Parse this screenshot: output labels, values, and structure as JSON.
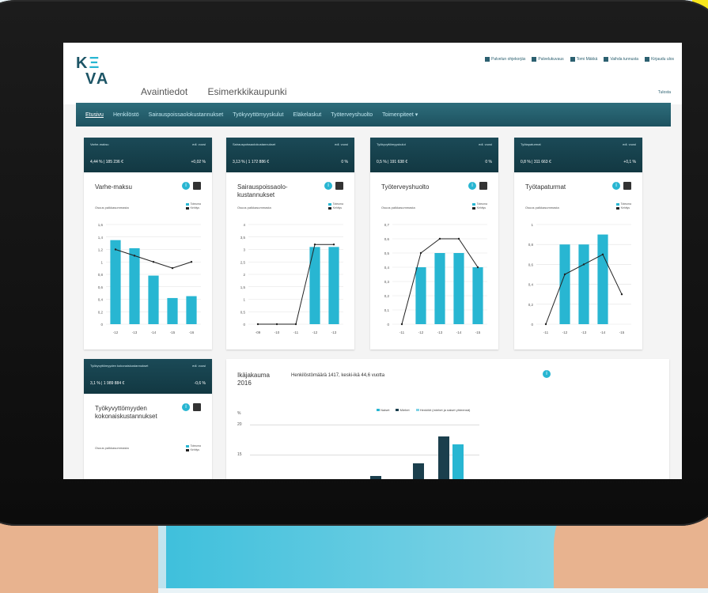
{
  "screen": {
    "title_app": "Avaintiedot",
    "title_org": "Esimerkkikaupunki",
    "top_links": [
      "Palvelun ohjekorjäs",
      "Palvelukuvaus",
      "Tomi Mäkkä",
      "Vaihda tunnusta",
      "Kirjaudu ulos"
    ],
    "print_label": "Tulosta",
    "nav": [
      "Etusivu",
      "Henkilöstö",
      "Sairauspoissaolokustannukset",
      "Työkyvyttömyyskulut",
      "Eläkelaskut",
      "Työterveyshuolto",
      "Toimenpiteet ▾"
    ]
  },
  "cards": [
    {
      "kpi_name": "Varhe-maksu",
      "kpi_info": "edl. vuosi",
      "kpi_value": "4,44 % | 185 236 €",
      "kpi_change": "+0,02 %",
      "title": "Varhe-maksu",
      "subhead": "Osuus palkkasummasta",
      "legend": [
        "Toteuma",
        "Kehitys"
      ],
      "chart_type": "bar+line",
      "categories": [
        "-12",
        "-13",
        "-14",
        "-15",
        "-16"
      ],
      "bars": [
        1.35,
        1.22,
        0.78,
        0.42,
        0.45
      ],
      "line": [
        1.2,
        1.1,
        1.0,
        0.9,
        1.0
      ],
      "ylim": [
        0,
        1.6
      ],
      "yticks": [
        "1,6",
        "1,4",
        "1,2",
        "1",
        "0,8",
        "0,6",
        "0,4",
        "0,2",
        "0"
      ]
    },
    {
      "kpi_name": "Sairauspoissaolokustannukset",
      "kpi_info": "edl. vuosi",
      "kpi_value": "3,13 % | 1 172 886 €",
      "kpi_change": "0 %",
      "title": "Sairauspoissaolo-kustannukset",
      "subhead": "Osuus palkkasummasta",
      "legend": [
        "Toteuma",
        "Kehitys"
      ],
      "chart_type": "bar+line",
      "categories": [
        "-09",
        "-10",
        "-11",
        "-12",
        "-13"
      ],
      "bars": [
        0,
        0,
        0,
        3.1,
        3.1
      ],
      "line": [
        0,
        0,
        0,
        3.2,
        3.2
      ],
      "ylim": [
        0,
        4
      ],
      "yticks": [
        "4",
        "3,5",
        "3",
        "2,5",
        "2",
        "1,5",
        "1",
        "0,5",
        "0"
      ]
    },
    {
      "kpi_name": "Työkyvyttömyyskulut",
      "kpi_info": "edl. vuosi",
      "kpi_value": "0,5 % | 191 638 €",
      "kpi_change": "0 %",
      "title": "Työterveyshuolto",
      "subhead": "Osuus palkkasummasta",
      "legend": [
        "Toteuma",
        "Kehitys"
      ],
      "chart_type": "bar+line",
      "categories": [
        "-11",
        "-12",
        "-13",
        "-14",
        "-15"
      ],
      "bars": [
        0,
        0.4,
        0.5,
        0.5,
        0.4
      ],
      "line": [
        0,
        0.5,
        0.6,
        0.6,
        0.4
      ],
      "ylim": [
        0,
        0.7
      ],
      "yticks": [
        "0,7",
        "0,6",
        "0,5",
        "0,4",
        "0,3",
        "0,2",
        "0,1",
        "0"
      ]
    },
    {
      "kpi_name": "Työtapaturmat",
      "kpi_info": "edl. vuosi",
      "kpi_value": "0,8 % | 311 663 €",
      "kpi_change": "+0,1 %",
      "title": "Työtapaturmat",
      "subhead": "Osuus palkkasummasta",
      "legend": [
        "Toteuma",
        "Kehitys"
      ],
      "chart_type": "bar+line",
      "categories": [
        "-11",
        "-12",
        "-13",
        "-14",
        "-15"
      ],
      "bars": [
        0,
        0.8,
        0.8,
        0.9,
        0
      ],
      "line": [
        0,
        0.5,
        0.6,
        0.7,
        0.3
      ],
      "ylim": [
        0,
        1
      ],
      "yticks": [
        "1",
        "0,8",
        "0,6",
        "0,4",
        "0,2",
        "0"
      ]
    }
  ],
  "bottom_left": {
    "kpi_name": "Työkyvyttömyyden kokonaiskustannukset",
    "kpi_info": "edl. vuosi",
    "kpi_value": "3,1 % | 1 989 884 €",
    "kpi_change": "-0,6 %",
    "title": "Työkyvyttömyyden kokonaiskustannukset",
    "subhead": "Osuus palkkasummasta",
    "legend": [
      "Toteuma",
      "Kehitys"
    ]
  },
  "bottom_right": {
    "title": "Ikäjakauma 2016",
    "subtitle": "Henkilöstömäärä 1417, keski-ikä 44,6 vuotta",
    "legend": [
      "Naiset",
      "Miehet",
      "Henkilöt (miehet ja naiset yhteensä)"
    ],
    "y_label": "%",
    "yticks": [
      "20",
      "15"
    ]
  },
  "colors": {
    "accent": "#28b6d2",
    "nav": "#1d5260",
    "kpi": "#123842",
    "line": "#222222"
  }
}
